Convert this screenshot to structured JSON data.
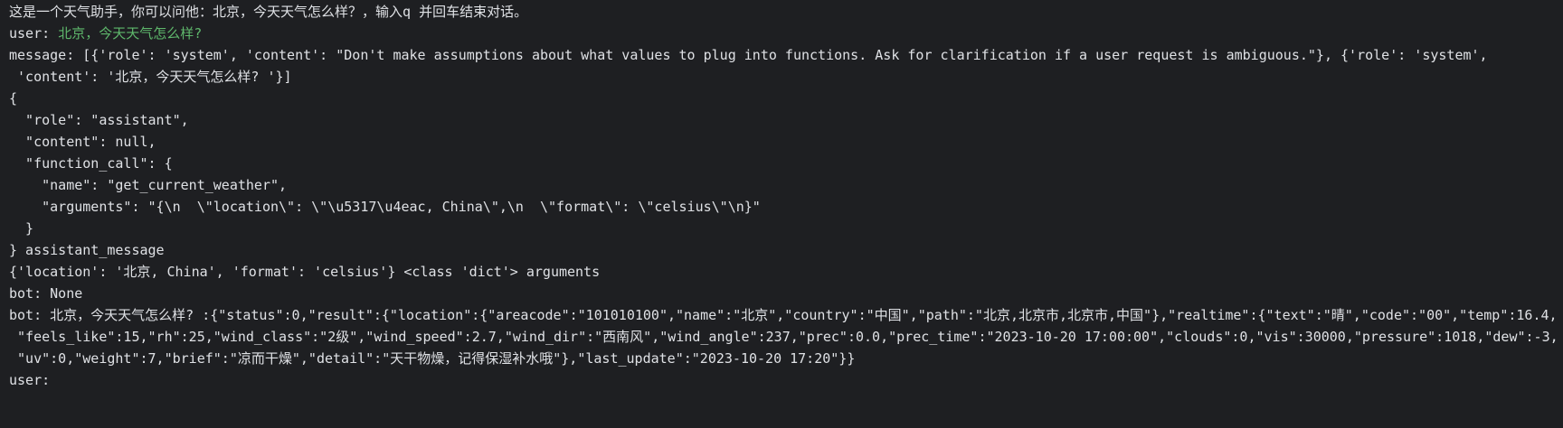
{
  "colors": {
    "background": "#1e1f22",
    "text": "#dfe1e5",
    "user_input": "#5fb86c"
  },
  "console": {
    "intro": "这是一个天气助手，你可以问他：北京，今天天气怎么样？，输入q 并回车结束对话。",
    "user_prompt": "user: ",
    "user_input": "北京，今天天气怎么样?",
    "lines": [
      "message: [{'role': 'system', 'content': \"Don't make assumptions about what values to plug into functions. Ask for clarification if a user request is ambiguous.\"}, {'role': 'system',",
      " 'content': '北京，今天天气怎么样? '}]",
      "{",
      "  \"role\": \"assistant\",",
      "  \"content\": null,",
      "  \"function_call\": {",
      "    \"name\": \"get_current_weather\",",
      "    \"arguments\": \"{\\n  \\\"location\\\": \\\"\\u5317\\u4eac, China\\\",\\n  \\\"format\\\": \\\"celsius\\\"\\n}\"",
      "  }",
      "} assistant_message",
      "{'location': '北京, China', 'format': 'celsius'} <class 'dict'> arguments",
      "bot: None",
      "bot: 北京，今天天气怎么样? :{\"status\":0,\"result\":{\"location\":{\"areacode\":\"101010100\",\"name\":\"北京\",\"country\":\"中国\",\"path\":\"北京,北京市,北京市,中国\"},\"realtime\":{\"text\":\"晴\",\"code\":\"00\",\"temp\":16.4,",
      " \"feels_like\":15,\"rh\":25,\"wind_class\":\"2级\",\"wind_speed\":2.7,\"wind_dir\":\"西南风\",\"wind_angle\":237,\"prec\":0.0,\"prec_time\":\"2023-10-20 17:00:00\",\"clouds\":0,\"vis\":30000,\"pressure\":1018,\"dew\":-3,",
      " \"uv\":0,\"weight\":7,\"brief\":\"凉而干燥\",\"detail\":\"天干物燥，记得保湿补水哦\"},\"last_update\":\"2023-10-20 17:20\"}}"
    ],
    "last_prompt": "user:"
  }
}
